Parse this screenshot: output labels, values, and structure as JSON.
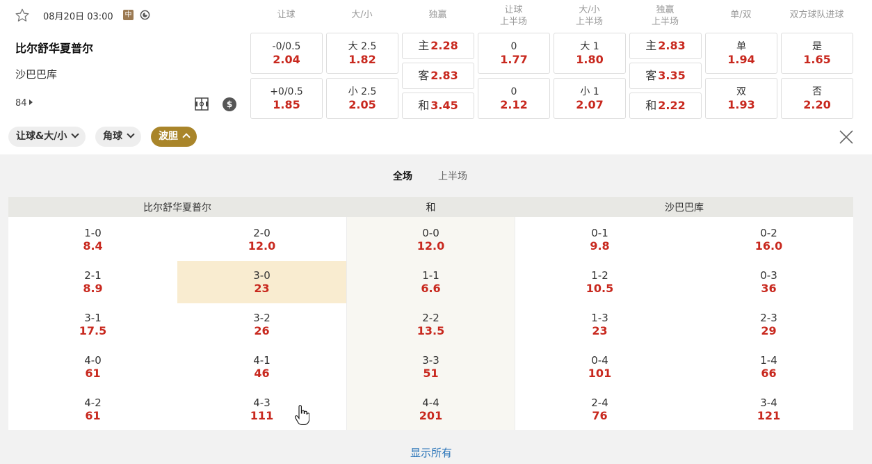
{
  "match": {
    "datetime": "08月20日 03:00",
    "neutral_badge": "中",
    "home": "比尔舒华夏普尔",
    "away": "沙巴巴库",
    "more_markets": "84"
  },
  "headers": [
    {
      "l1": "让球",
      "l2": ""
    },
    {
      "l1": "大/小",
      "l2": ""
    },
    {
      "l1": "独赢",
      "l2": ""
    },
    {
      "l1": "让球",
      "l2": "上半场"
    },
    {
      "l1": "大/小",
      "l2": "上半场"
    },
    {
      "l1": "独赢",
      "l2": "上半场"
    },
    {
      "l1": "单/双",
      "l2": ""
    },
    {
      "l1": "双方球队进球",
      "l2": ""
    }
  ],
  "odds": {
    "hdp_home": {
      "label": "-0/0.5",
      "odds": "2.04"
    },
    "hdp_away": {
      "label": "+0/0.5",
      "odds": "1.85"
    },
    "ou_over": {
      "label": "大 2.5",
      "odds": "1.82"
    },
    "ou_under": {
      "label": "小 2.5",
      "odds": "2.05"
    },
    "x12_home": {
      "label": "主",
      "odds": "2.28"
    },
    "x12_away": {
      "label": "客",
      "odds": "2.83"
    },
    "x12_draw": {
      "label": "和",
      "odds": "3.45"
    },
    "h1_hdp_home": {
      "label": "0",
      "odds": "1.77"
    },
    "h1_hdp_away": {
      "label": "0",
      "odds": "2.12"
    },
    "h1_ou_over": {
      "label": "大 1",
      "odds": "1.80"
    },
    "h1_ou_under": {
      "label": "小 1",
      "odds": "2.07"
    },
    "h1_x12_home": {
      "label": "主",
      "odds": "2.83"
    },
    "h1_x12_away": {
      "label": "客",
      "odds": "3.35"
    },
    "h1_x12_draw": {
      "label": "和",
      "odds": "2.22"
    },
    "oe_odd": {
      "label": "单",
      "odds": "1.94"
    },
    "oe_even": {
      "label": "双",
      "odds": "1.93"
    },
    "btts_yes": {
      "label": "是",
      "odds": "1.65"
    },
    "btts_no": {
      "label": "否",
      "odds": "2.20"
    }
  },
  "chips": [
    {
      "label": "让球&大/小"
    },
    {
      "label": "角球"
    },
    {
      "label": "波胆"
    }
  ],
  "period_tabs": [
    {
      "label": "全场"
    },
    {
      "label": "上半场"
    }
  ],
  "cs_headers": {
    "home": "比尔舒华夏普尔",
    "draw": "和",
    "away": "沙巴巴库"
  },
  "correct_score": [
    [
      {
        "s": "1-0",
        "o": "8.4"
      },
      {
        "s": "2-0",
        "o": "12.0"
      },
      {
        "s": "0-0",
        "o": "12.0"
      },
      {
        "s": "0-1",
        "o": "9.8"
      },
      {
        "s": "0-2",
        "o": "16.0"
      }
    ],
    [
      {
        "s": "2-1",
        "o": "8.9"
      },
      {
        "s": "3-0",
        "o": "23"
      },
      {
        "s": "1-1",
        "o": "6.6"
      },
      {
        "s": "1-2",
        "o": "10.5"
      },
      {
        "s": "0-3",
        "o": "36"
      }
    ],
    [
      {
        "s": "3-1",
        "o": "17.5"
      },
      {
        "s": "3-2",
        "o": "26"
      },
      {
        "s": "2-2",
        "o": "13.5"
      },
      {
        "s": "1-3",
        "o": "23"
      },
      {
        "s": "2-3",
        "o": "29"
      }
    ],
    [
      {
        "s": "4-0",
        "o": "61"
      },
      {
        "s": "4-1",
        "o": "46"
      },
      {
        "s": "3-3",
        "o": "51"
      },
      {
        "s": "0-4",
        "o": "101"
      },
      {
        "s": "1-4",
        "o": "66"
      }
    ],
    [
      {
        "s": "4-2",
        "o": "61"
      },
      {
        "s": "4-3",
        "o": "111"
      },
      {
        "s": "4-4",
        "o": "201"
      },
      {
        "s": "2-4",
        "o": "76"
      },
      {
        "s": "3-4",
        "o": "121"
      }
    ]
  ],
  "show_all": "显示所有",
  "colors": {
    "accent": "#a9852a",
    "odds": "#c8281e",
    "link": "#2873b8",
    "highlight": "#f9ecd0"
  }
}
